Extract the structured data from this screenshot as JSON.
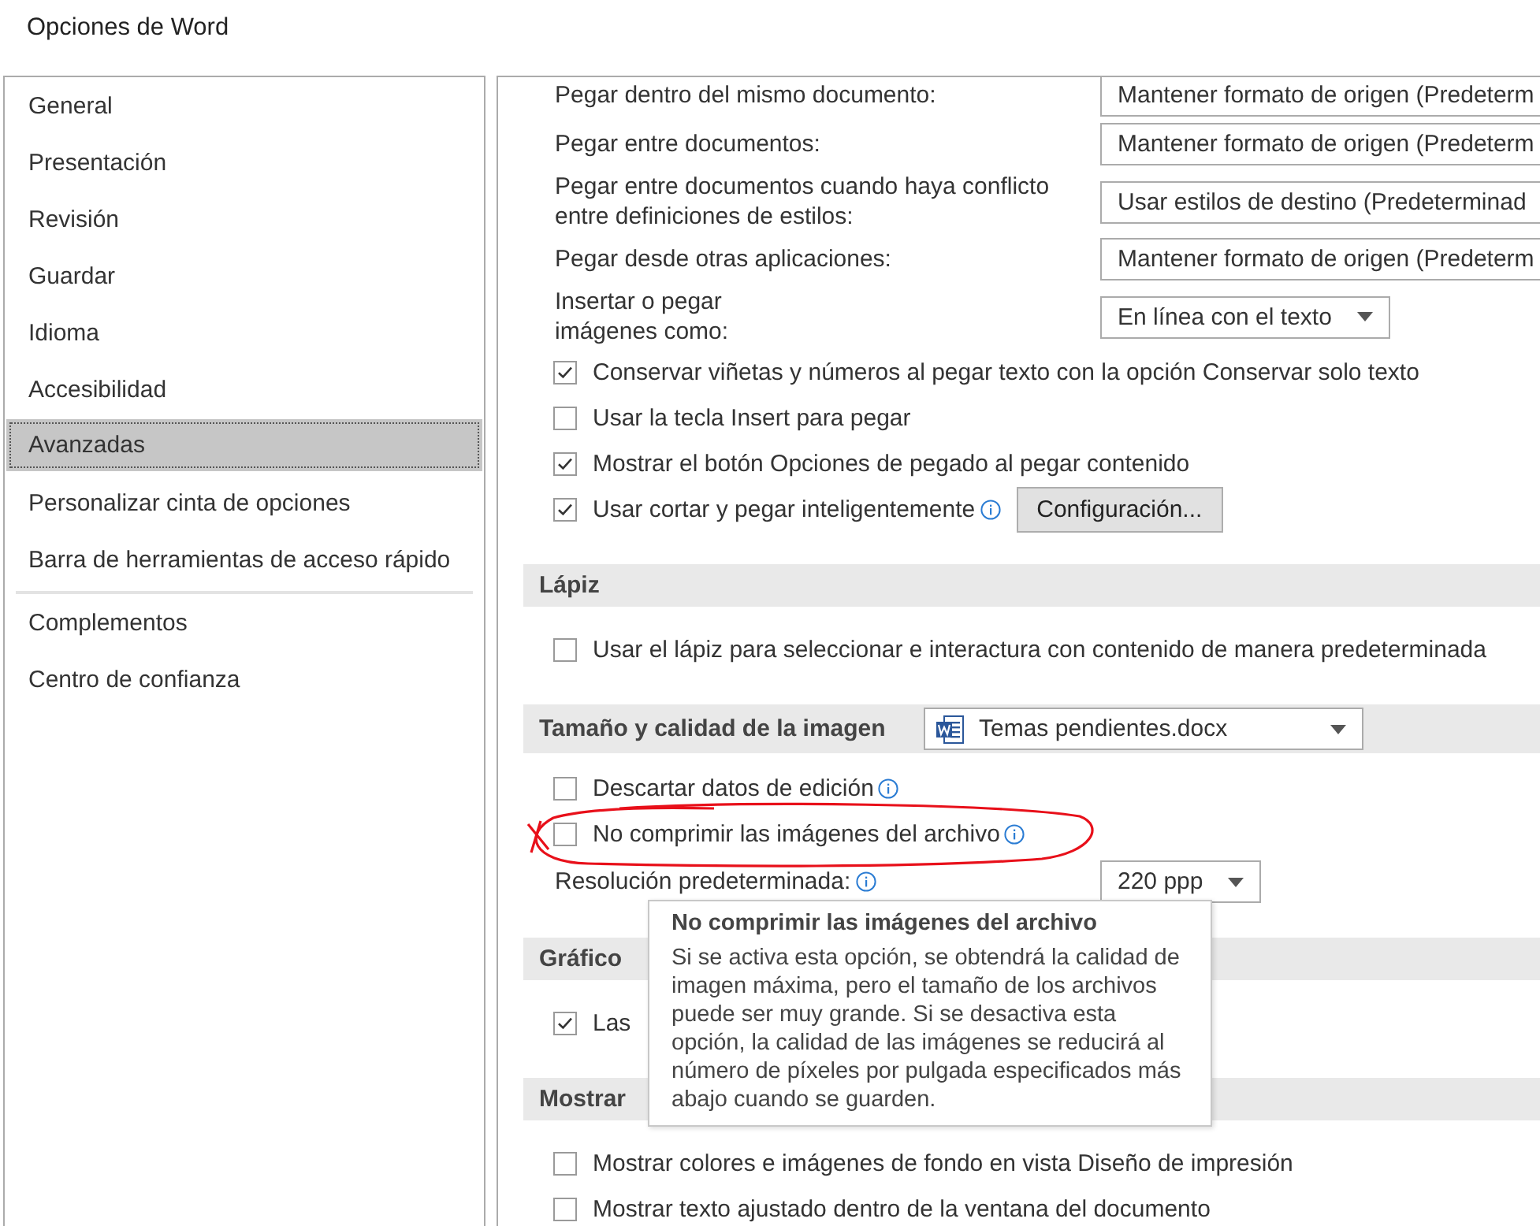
{
  "window": {
    "title": "Opciones de Word"
  },
  "sidebar": {
    "groups": [
      [
        {
          "label": "General",
          "selected": false
        },
        {
          "label": "Presentación",
          "selected": false
        },
        {
          "label": "Revisión",
          "selected": false
        },
        {
          "label": "Guardar",
          "selected": false
        },
        {
          "label": "Idioma",
          "selected": false
        },
        {
          "label": "Accesibilidad",
          "selected": false
        },
        {
          "label": "Avanzadas",
          "selected": true
        },
        {
          "label": "Personalizar cinta de opciones",
          "selected": false
        },
        {
          "label": "Barra de herramientas de acceso rápido",
          "selected": false
        }
      ],
      [
        {
          "label": "Complementos",
          "selected": false
        },
        {
          "label": "Centro de confianza",
          "selected": false
        }
      ]
    ]
  },
  "content": {
    "rows": [
      {
        "kind": "select",
        "label": [
          "Pegar dentro del mismo documento:"
        ],
        "value": "Mantener formato de origen (Predeterm",
        "arrow": false,
        "info": false
      },
      {
        "kind": "select",
        "label": [
          "Pegar entre documentos:"
        ],
        "value": "Mantener formato de origen (Predeterm",
        "arrow": false,
        "info": false
      },
      {
        "kind": "select",
        "label": [
          "Pegar entre documentos cuando haya conflicto",
          "entre definiciones de estilos:"
        ],
        "value": "Usar estilos de destino (Predeterminad",
        "arrow": false,
        "info": false
      },
      {
        "kind": "select",
        "label": [
          "Pegar desde otras aplicaciones:"
        ],
        "value": "Mantener formato de origen (Predeterm",
        "arrow": false,
        "info": false
      },
      {
        "kind": "select",
        "label": [
          "Insertar o pegar",
          "imágenes como:"
        ],
        "value": "En línea con el texto",
        "arrow": true,
        "info": false
      },
      {
        "kind": "checkbox",
        "label": "Conservar viñetas y números al pegar texto con la opción Conservar solo texto",
        "checked": true,
        "circled": false,
        "info": false
      },
      {
        "kind": "checkbox",
        "label": "Usar la tecla Insert para pegar",
        "checked": false,
        "circled": false,
        "info": false
      },
      {
        "kind": "checkbox",
        "label": "Mostrar el botón Opciones de pegado al pegar contenido",
        "checked": true,
        "circled": false,
        "info": false
      },
      {
        "kind": "checkbox",
        "label": "Usar cortar y pegar inteligentemente",
        "checked": true,
        "circled": false,
        "info": true,
        "button": "Configuración..."
      },
      {
        "kind": "header",
        "label": "Lápiz"
      },
      {
        "kind": "checkbox",
        "label": "Usar el lápiz para seleccionar e interactura con contenido de manera predeterminada",
        "checked": false,
        "circled": false,
        "info": false
      },
      {
        "kind": "header",
        "label": "Tamaño y calidad de la imagen",
        "select": {
          "value": "Temas pendientes.docx",
          "arrow": true
        }
      },
      {
        "kind": "checkbox",
        "label": "Descartar datos de edición",
        "checked": false,
        "circled": false,
        "info": true
      },
      {
        "kind": "checkbox",
        "label": "No comprimir las imágenes del archivo",
        "checked": false,
        "circled": true,
        "info": true
      },
      {
        "kind": "select",
        "label": [
          "Resolución predeterminada:"
        ],
        "value": "220 ppp",
        "arrow": true,
        "info": true
      },
      {
        "kind": "header",
        "label": "Gráfico"
      },
      {
        "kind": "checkbox",
        "label": "Las",
        "checked": true,
        "circled": false,
        "info": false
      },
      {
        "kind": "header",
        "label": "Mostrar"
      },
      {
        "kind": "checkbox",
        "label": "Mostrar colores e imágenes de fondo en vista Diseño de impresión",
        "checked": false,
        "circled": false,
        "info": false
      },
      {
        "kind": "checkbox",
        "label": "Mostrar texto ajustado dentro de la ventana del documento",
        "checked": false,
        "circled": false,
        "info": false
      }
    ]
  },
  "tooltip": {
    "title": "No comprimir las imágenes del archivo",
    "text": "Si se activa esta opción, se obtendrá la calidad de imagen máxima, pero el tamaño de los archivos puede ser muy grande. Si se desactiva esta opción, la calidad de las imágenes se reducirá al número de píxeles por pulgada especificados más abajo cuando se guarden."
  }
}
